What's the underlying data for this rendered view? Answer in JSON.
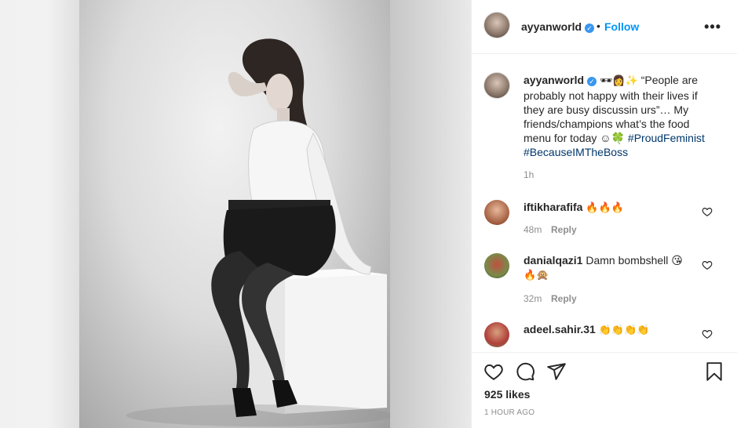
{
  "post": {
    "username": "ayyanworld",
    "verified_mark": "✓",
    "separator": "•",
    "follow_label": "Follow",
    "more_label": "•••"
  },
  "caption": {
    "username": "ayyanworld",
    "emojis": "🕶👩✨",
    "text": "“People are probably not happy with their lives if they are busy discussin urs”… My friends/champions what’s the food menu for today ☺🍀",
    "hashtag1": "#ProudFeminist",
    "hashtag2": "#BecauseIMTheBoss",
    "time": "1h"
  },
  "comments": [
    {
      "username": "iftikharafifa",
      "text": "🔥🔥🔥",
      "time": "48m",
      "reply": "Reply"
    },
    {
      "username": "danialqazi1",
      "text": "Damn bombshell 😘",
      "text2": "🔥🙊",
      "time": "32m",
      "reply": "Reply"
    },
    {
      "username": "adeel.sahir.31",
      "text": "👏👏👏👏"
    }
  ],
  "actions": {
    "like_icon": "heart-icon",
    "comment_icon": "comment-icon",
    "share_icon": "share-icon",
    "save_icon": "bookmark-icon"
  },
  "likes": "925 likes",
  "posted": "1 HOUR AGO"
}
